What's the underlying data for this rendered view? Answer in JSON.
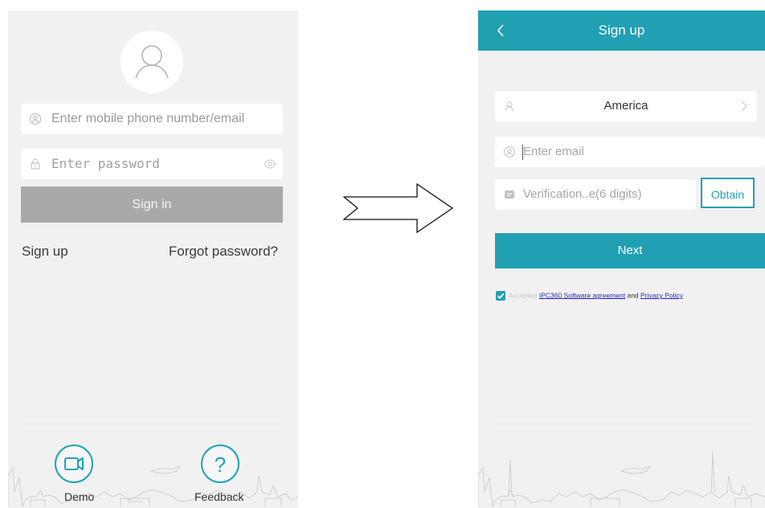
{
  "left_screen": {
    "username_placeholder": "Enter mobile phone number/email",
    "password_placeholder": "Enter password",
    "signin_label": "Sign in",
    "signup_label": "Sign up",
    "forgot_label": "Forgot password?",
    "demo_label": "Demo",
    "feedback_label": "Feedback"
  },
  "right_screen": {
    "title": "Sign up",
    "region_value": "America",
    "email_placeholder": "Enter email",
    "code_placeholder": "Verification..e(6 digits)",
    "obtain_label": "Obtain",
    "next_label": "Next",
    "agreement": {
      "prefix": "Accepted",
      "software_link": "IPC360 Software agreement",
      "joiner": "and",
      "privacy_link": "Privacy Policy",
      "checked": true
    }
  },
  "colors": {
    "accent": "#21a0b3",
    "screen_bg": "#f1f1f1",
    "disabled_button": "#a9a9a9"
  },
  "icons": [
    "avatar-icon",
    "user-circle-icon",
    "lock-icon",
    "eye-icon",
    "video-camera-icon",
    "question-icon",
    "back-chevron-icon",
    "region-icon",
    "chevron-right-icon",
    "email-user-icon",
    "message-icon",
    "checkmark-icon",
    "right-arrow-icon"
  ]
}
